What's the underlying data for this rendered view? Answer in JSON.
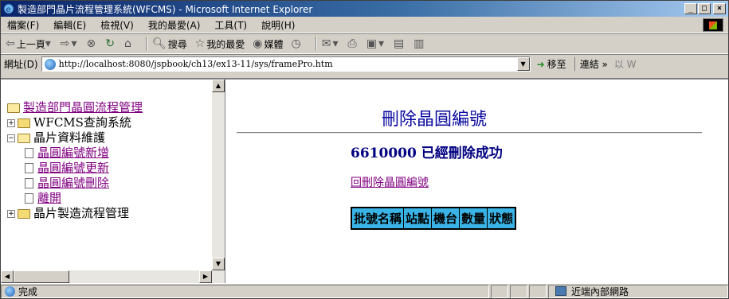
{
  "window": {
    "title": "製造部門晶片流程管理系統(WFCMS) - Microsoft Internet Explorer",
    "minimize": "_",
    "maximize": "□",
    "close": "×"
  },
  "menubar": {
    "items": [
      "檔案(F)",
      "編輯(E)",
      "檢視(V)",
      "我的最愛(A)",
      "工具(T)",
      "說明(H)"
    ]
  },
  "toolbar": {
    "back_label": "上一頁",
    "search_label": "搜尋",
    "favorites_label": "我的最愛",
    "media_label": "媒體"
  },
  "address": {
    "label": "網址(D)",
    "url": "http://localhost:8080/jspbook/ch13/ex13-11/sys/framePro.htm",
    "go_label": "移至",
    "links_label": "連結 »",
    "windows_label": "以 W"
  },
  "tree": {
    "root": "製造部門晶圓流程管理",
    "wfcms": "WFCMS查詢系統",
    "chip_maintenance": "晶片資料維護",
    "children": [
      "晶圓編號新增",
      "晶圓編號更新",
      "晶圓編號刪除",
      "離開"
    ],
    "chip_flow": "晶片製造流程管理"
  },
  "main": {
    "title": "刪除晶圓編號",
    "message": "6610000 已經刪除成功",
    "back_link": "回刪除晶圓編號",
    "table_headers": [
      "批號名稱",
      "站點",
      "機台",
      "數量",
      "狀態"
    ]
  },
  "status": {
    "text": "完成",
    "zone": "近端內部網路"
  }
}
